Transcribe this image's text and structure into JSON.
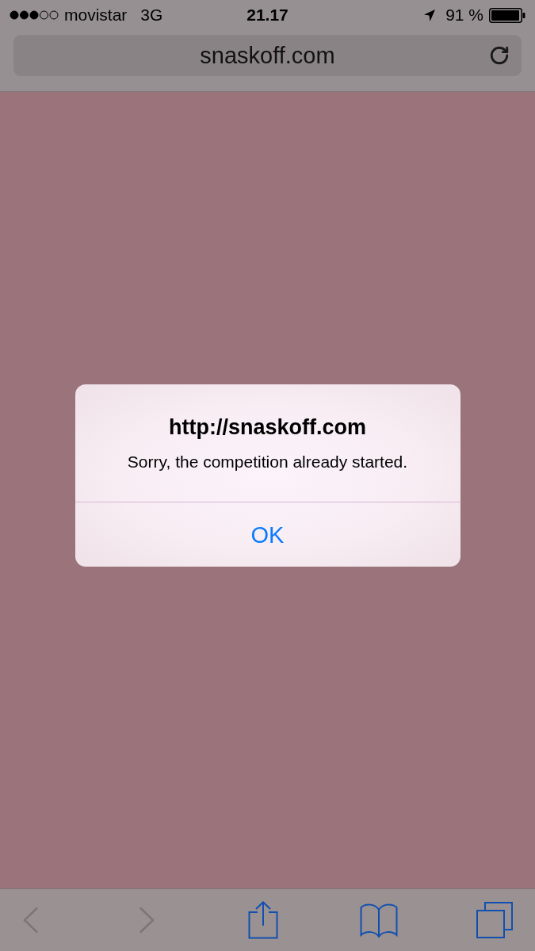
{
  "status_bar": {
    "carrier": "movistar",
    "network": "3G",
    "time": "21.17",
    "battery": "91 %"
  },
  "address_bar": {
    "url": "snaskoff.com"
  },
  "alert": {
    "title": "http://snaskoff.com",
    "message": "Sorry, the competition already started.",
    "buttons": [
      "OK"
    ]
  },
  "toolbar": {
    "items": [
      {
        "kind": "back",
        "disabled": true
      },
      {
        "kind": "forward",
        "disabled": true
      },
      {
        "kind": "share",
        "disabled": false
      },
      {
        "kind": "bookmarks",
        "disabled": false
      },
      {
        "kind": "tabs",
        "disabled": false
      }
    ]
  }
}
